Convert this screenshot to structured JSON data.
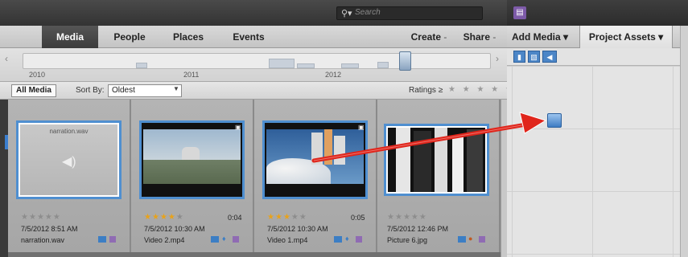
{
  "search": {
    "placeholder": "Search"
  },
  "tabs": [
    {
      "label": "Media"
    },
    {
      "label": "People"
    },
    {
      "label": "Places"
    },
    {
      "label": "Events"
    }
  ],
  "actions": {
    "create": "Create",
    "share": "Share"
  },
  "timeline": {
    "labels": [
      "2010",
      "2011",
      "2012"
    ]
  },
  "filter": {
    "all_media": "All Media",
    "sort_by": "Sort By:",
    "sort_value": "Oldest",
    "ratings": "Ratings",
    "ratings_op": "≥",
    "stars": "★ ★ ★ ★ ★"
  },
  "media_items": [
    {
      "thumb_label": "narration.wav",
      "rating_stars": "★★★★★",
      "rating": 0,
      "duration": "",
      "date": "7/5/2012 8:51 AM",
      "filename": "narration.wav",
      "type": "audio"
    },
    {
      "thumb_label": "",
      "rating_stars": "★★★★★",
      "rating": 4,
      "duration": "0:04",
      "date": "7/5/2012 10:30 AM",
      "filename": "Video 2.mp4",
      "type": "video"
    },
    {
      "thumb_label": "",
      "rating_stars": "★★★★★",
      "rating": 3,
      "duration": "0:05",
      "date": "7/5/2012 10:30 AM",
      "filename": "Video 1.mp4",
      "type": "video"
    },
    {
      "thumb_label": "",
      "rating_stars": "★★★★★",
      "rating": 0,
      "duration": "",
      "date": "7/5/2012 12:46 PM",
      "filename": "Picture 6.jpg",
      "type": "photo"
    }
  ],
  "right_panel": {
    "add_media": "Add Media",
    "project_assets": "Project Assets",
    "dropdown_arrow": "▾"
  },
  "icons": [
    "search-icon",
    "video-icon",
    "photo-icon",
    "audio-icon",
    "gps-icon",
    "tag-icon",
    "drop-cursor-icon"
  ],
  "colors": {
    "accent_blue": "#4f8fd0",
    "star_gold": "#e8a21a",
    "arrow_red": "#e0251b"
  }
}
